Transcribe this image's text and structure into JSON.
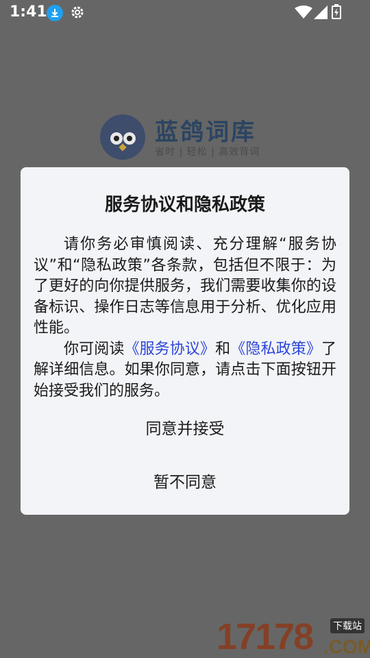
{
  "status_bar": {
    "time": "1:41",
    "icons": [
      "download-icon",
      "gear-icon",
      "wifi-icon",
      "signal-icon",
      "battery-icon"
    ]
  },
  "splash": {
    "app_name": "蓝鸽词库",
    "tagline": "省时 | 轻松 | 高效背词"
  },
  "dialog": {
    "title": "服务协议和隐私政策",
    "para1": "请你务必审慎阅读、充分理解“服务协议”和“隐私政策”各条款，包括但不限于：为了更好的向你提供服务，我们需要收集你的设备标识、操作日志等信息用于分析、优化应用性能。",
    "para2_prefix": "你可阅读",
    "link_service": "《服务协议》",
    "para2_and": "和",
    "link_privacy": "《隐私政策》",
    "para2_suffix": "了解详细信息。如果你同意，请点击下面按钮开始接受我们的服务。",
    "agree_label": "同意并接受",
    "disagree_label": "暂不同意"
  },
  "watermark": {
    "number": "17178",
    "badge": "下载站",
    "domain": ".COM"
  },
  "colors": {
    "overlay": "#666666",
    "dialog_bg": "#f3f4f8",
    "link": "#2c46d8",
    "brand": "#2b4462"
  }
}
